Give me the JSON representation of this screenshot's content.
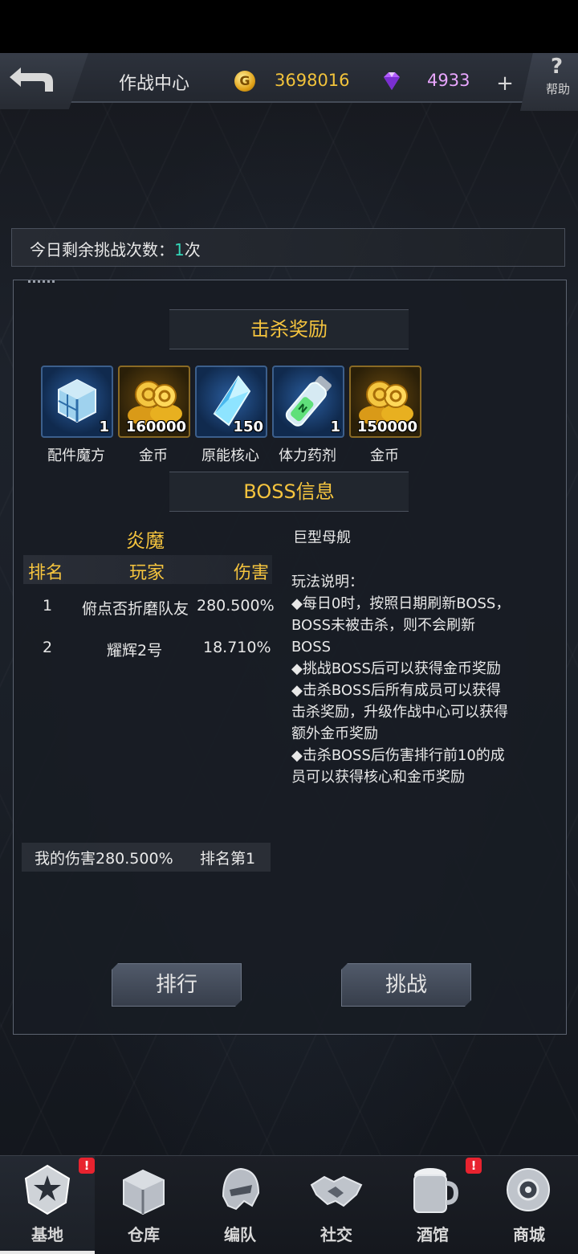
{
  "header": {
    "title": "作战中心",
    "gold": "3698016",
    "gems": "4933",
    "plus": "+",
    "help_icon": "?",
    "help": "帮助",
    "coin_symbol": "G"
  },
  "challenge": {
    "label": "今日剩余挑战次数：",
    "count": "1",
    "unit": "次"
  },
  "rewards": {
    "title": "击杀奖励",
    "items": [
      {
        "name": "配件魔方",
        "qty": "1",
        "icon": "cube-icon"
      },
      {
        "name": "金币",
        "qty": "160000",
        "icon": "gold-coins-icon"
      },
      {
        "name": "原能核心",
        "qty": "150",
        "icon": "crystal-core-icon"
      },
      {
        "name": "体力药剂",
        "qty": "1",
        "icon": "stamina-potion-icon"
      },
      {
        "name": "金币",
        "qty": "150000",
        "icon": "gold-coins-icon"
      }
    ]
  },
  "boss": {
    "section_title": "BOSS信息",
    "name": "炎魔",
    "type": "巨型母舰",
    "ranking": {
      "headers": [
        "排名",
        "玩家",
        "伤害"
      ],
      "rows": [
        {
          "rank": "1",
          "player": "俯点否折磨队友",
          "damage": "280.500%"
        },
        {
          "rank": "2",
          "player": "耀辉2号",
          "damage": "18.710%"
        }
      ]
    },
    "my_damage_label": "我的伤害280.500%",
    "my_rank_label": "排名第1",
    "rules": [
      "玩法说明：",
      "◆每日0时，按照日期刷新BOSS，",
      "BOSS未被击杀，则不会刷新",
      "BOSS",
      "◆挑战BOSS后可以获得金币奖励",
      "◆击杀BOSS后所有成员可以获得",
      "击杀奖励，升级作战中心可以获得",
      "额外金币奖励",
      "◆击杀BOSS后伤害排行前10的成",
      "员可以获得核心和金币奖励"
    ]
  },
  "buttons": {
    "ranking": "排行",
    "challenge": "挑战"
  },
  "nav": {
    "items": [
      {
        "label": "基地",
        "badge": "!",
        "active": true
      },
      {
        "label": "仓库",
        "badge": "",
        "active": false
      },
      {
        "label": "编队",
        "badge": "",
        "active": false
      },
      {
        "label": "社交",
        "badge": "",
        "active": false
      },
      {
        "label": "酒馆",
        "badge": "!",
        "active": false
      },
      {
        "label": "商城",
        "badge": "",
        "active": false
      }
    ]
  },
  "colors": {
    "accent_gold": "#f5c43e",
    "count_highlight": "#34d6b8",
    "badge_red": "#e8232f"
  }
}
